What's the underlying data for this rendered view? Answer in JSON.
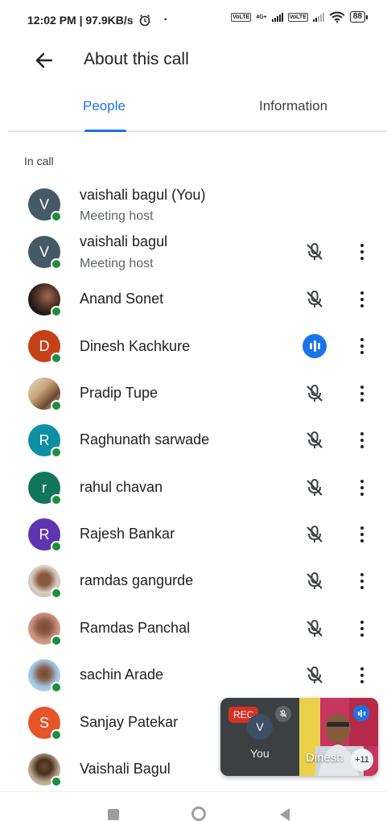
{
  "status": {
    "time_speed": "12:02 PM | 97.9KB/s",
    "net1": "VoLTE",
    "net2": "4G+",
    "net3": "VoLTE",
    "battery": "88"
  },
  "appbar": {
    "title": "About this call"
  },
  "tabs": [
    {
      "label": "People",
      "selected": true
    },
    {
      "label": "Information",
      "selected": false
    }
  ],
  "section": {
    "label": "In call"
  },
  "participants": [
    {
      "name": "vaishali bagul (You)",
      "role": "Meeting host",
      "initial": "V",
      "color": "#455a64",
      "mic": "none"
    },
    {
      "name": "vaishali bagul",
      "role": "Meeting host",
      "initial": "V",
      "color": "#455a64",
      "mic": "muted"
    },
    {
      "name": "Anand Sonet",
      "role": "",
      "initial": "",
      "color": "#3a2f28",
      "mic": "muted"
    },
    {
      "name": "Dinesh Kachkure",
      "role": "",
      "initial": "D",
      "color": "#c5411a",
      "mic": "speaking"
    },
    {
      "name": "Pradip Tupe",
      "role": "",
      "initial": "",
      "color": "#b8a07a",
      "mic": "muted"
    },
    {
      "name": "Raghunath sarwade",
      "role": "",
      "initial": "R",
      "color": "#0f8fa3",
      "mic": "muted"
    },
    {
      "name": "rahul chavan",
      "role": "",
      "initial": "r",
      "color": "#11765c",
      "mic": "muted"
    },
    {
      "name": "Rajesh Bankar",
      "role": "",
      "initial": "R",
      "color": "#5e35b1",
      "mic": "muted"
    },
    {
      "name": "ramdas gangurde",
      "role": "",
      "initial": "",
      "color": "#c7b8a6",
      "mic": "muted"
    },
    {
      "name": "Ramdas Panchal",
      "role": "",
      "initial": "",
      "color": "#a97a68",
      "mic": "muted"
    },
    {
      "name": "sachin Arade",
      "role": "",
      "initial": "",
      "color": "#6d9fc7",
      "mic": "muted"
    },
    {
      "name": "Sanjay Patekar",
      "role": "",
      "initial": "S",
      "color": "#e8542a",
      "mic": "muted"
    },
    {
      "name": "Vaishali Bagul",
      "role": "",
      "initial": "",
      "color": "#6a5a4a",
      "mic": "muted"
    }
  ],
  "pip": {
    "rec": "REC",
    "self_initial": "V",
    "self_label": "You",
    "other_name": "Dinesh",
    "more_count": "+11"
  }
}
